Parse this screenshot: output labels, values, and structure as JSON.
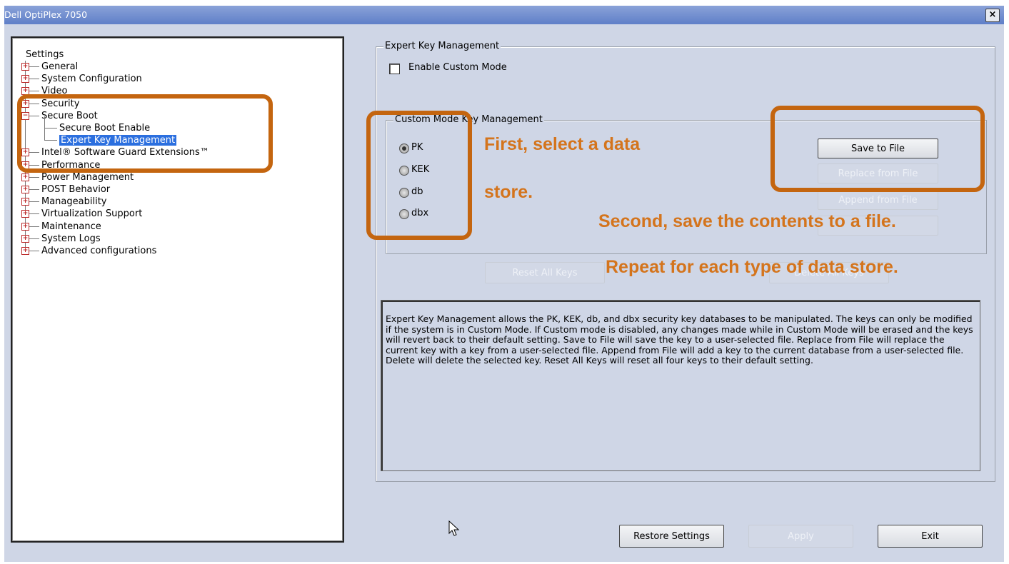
{
  "window": {
    "title": "Dell OptiPlex 7050",
    "close_label": "×"
  },
  "tree": {
    "root": "Settings",
    "items": [
      {
        "label": "General",
        "expander": "+"
      },
      {
        "label": "System Configuration",
        "expander": "+"
      },
      {
        "label": "Video",
        "expander": "+"
      },
      {
        "label": "Security",
        "expander": "+"
      },
      {
        "label": "Secure Boot",
        "expander": "−"
      },
      {
        "label": "Secure Boot Enable",
        "child": true
      },
      {
        "label": "Expert Key Management",
        "child": true,
        "selected": true
      },
      {
        "label": "Intel® Software Guard Extensions™",
        "expander": "+"
      },
      {
        "label": "Performance",
        "expander": "+"
      },
      {
        "label": "Power Management",
        "expander": "+"
      },
      {
        "label": "POST Behavior",
        "expander": "+"
      },
      {
        "label": "Manageability",
        "expander": "+"
      },
      {
        "label": "Virtualization Support",
        "expander": "+"
      },
      {
        "label": "Maintenance",
        "expander": "+"
      },
      {
        "label": "System Logs",
        "expander": "+"
      },
      {
        "label": "Advanced configurations",
        "expander": "+"
      }
    ]
  },
  "expert_key": {
    "group_title": "Expert Key Management",
    "enable_custom_mode": {
      "label": "Enable Custom Mode",
      "checked": false
    },
    "custom_mode_group_title": "Custom Mode Key Management",
    "radios": [
      {
        "label": "PK",
        "selected": true
      },
      {
        "label": "KEK",
        "selected": false
      },
      {
        "label": "db",
        "selected": false
      },
      {
        "label": "dbx",
        "selected": false
      }
    ],
    "buttons": {
      "save_to_file": "Save to File",
      "replace_from_file": "Replace from File",
      "append_from_file": "Append from File",
      "reset_all_keys": "Reset All Keys",
      "delete_all_keys": "Delete All Keys"
    }
  },
  "description": "Expert Key Management allows the PK, KEK, db, and dbx security key databases to be manipulated. The keys can only be modified if the system is in Custom Mode. If Custom mode is disabled, any changes made while in Custom Mode will be erased and the keys will revert back to their default setting. Save to File will save the key to a user-selected file. Replace from File will replace the current key with a key from a user-selected file. Append from File will add a key to the current database from a user-selected file. Delete will delete the selected key. Reset All Keys will reset all four keys to their default setting.",
  "footer": {
    "restore_settings": "Restore Settings",
    "apply": "Apply",
    "exit": "Exit"
  },
  "annotations": {
    "step1_line1": "First, select a data",
    "step1_line2": "store.",
    "step2": "Second, save the contents to a file.",
    "step3": "Repeat for each type of data store."
  },
  "colors": {
    "annotation_orange": "#c4650f",
    "annotation_text": "#d4741c",
    "selection_blue": "#2b6fdf",
    "window_bg": "#cfd6e6"
  }
}
